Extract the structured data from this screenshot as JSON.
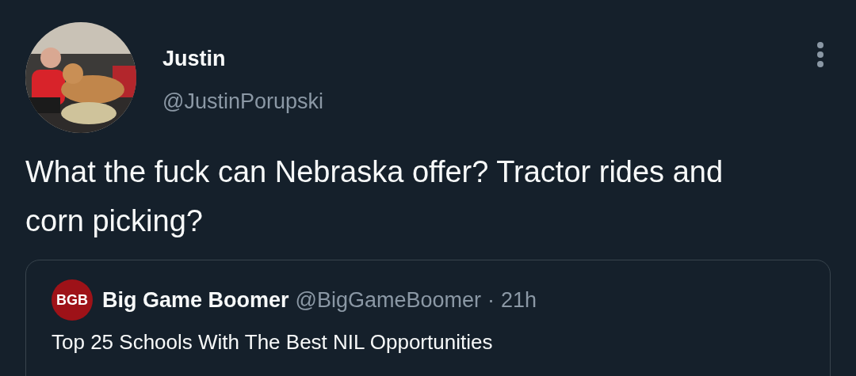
{
  "author": {
    "name": "Justin",
    "handle": "@JustinPorupski"
  },
  "tweet_text": "What the fuck can Nebraska offer? Tractor rides and corn picking?",
  "quoted_tweet": {
    "logo_text": "BGB",
    "name": "Big Game Boomer",
    "handle": "@BigGameBoomer",
    "separator": "·",
    "time": "21h",
    "text": "Top 25 Schools With The Best NIL Opportunities"
  }
}
